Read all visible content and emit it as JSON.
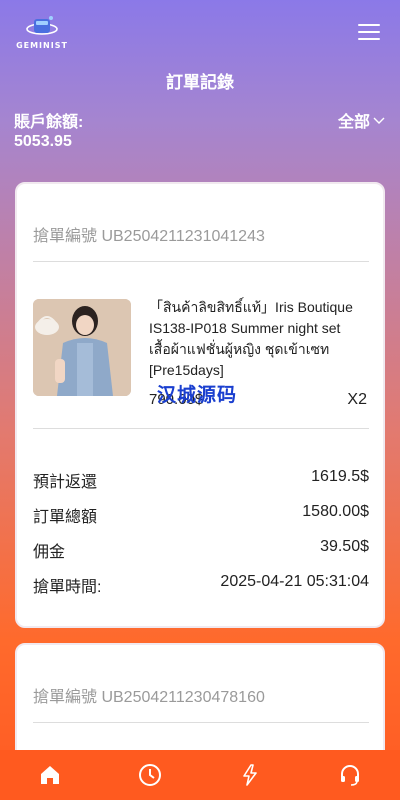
{
  "brand": {
    "logo_text": "GEMINIST"
  },
  "header": {
    "title": "訂單記錄",
    "menu_icon": "hamburger-menu-icon"
  },
  "balance": {
    "label": "賬戶餘額:",
    "value": "5053.95"
  },
  "filter": {
    "label": "全部",
    "icon": "chevron-down-icon"
  },
  "orders": [
    {
      "order_no": "搶單編號 UB2504211231041243",
      "product_name": "「สินค้าลิขสิทธิ์แท้」Iris Boutique IS138-IP018 Summer night set เสื้อผ้าแฟชั่นผู้หญิง ชุดเข้าเซท [Pre15days]",
      "price": "790.00$",
      "qty": "X2",
      "rows": [
        {
          "label": "預計返還",
          "value": "1619.5$"
        },
        {
          "label": "訂單總額",
          "value": "1580.00$"
        },
        {
          "label": "佣金",
          "value": "39.50$"
        },
        {
          "label": "搶單時間:",
          "value": "2025-04-21 05:31:04"
        }
      ]
    },
    {
      "order_no": "搶單編號 UB2504211230478160"
    }
  ],
  "watermark": "汉城源码",
  "bottom_nav": [
    {
      "icon": "home-icon",
      "active": true
    },
    {
      "icon": "clock-icon",
      "active": false
    },
    {
      "icon": "lightning-icon",
      "active": false
    },
    {
      "icon": "headset-support-icon",
      "active": false
    }
  ],
  "colors": {
    "gradient_top": "#8b79e8",
    "gradient_bottom": "#ff5a22",
    "nav_bar": "#ff5a1f",
    "card_bg": "#ffffff"
  }
}
